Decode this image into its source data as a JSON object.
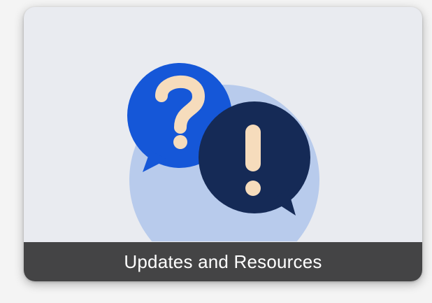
{
  "card": {
    "label": "Updates and Resources",
    "icon": "question-exclamation-speech-bubbles-icon",
    "colors": {
      "card_background": "#e9ebf0",
      "circle_background": "#b8cbec",
      "question_bubble": "#1557d8",
      "exclamation_bubble": "#152a56",
      "glyph": "#f6dcbc",
      "caption_background": "#444445",
      "caption_text": "#ffffff"
    }
  }
}
